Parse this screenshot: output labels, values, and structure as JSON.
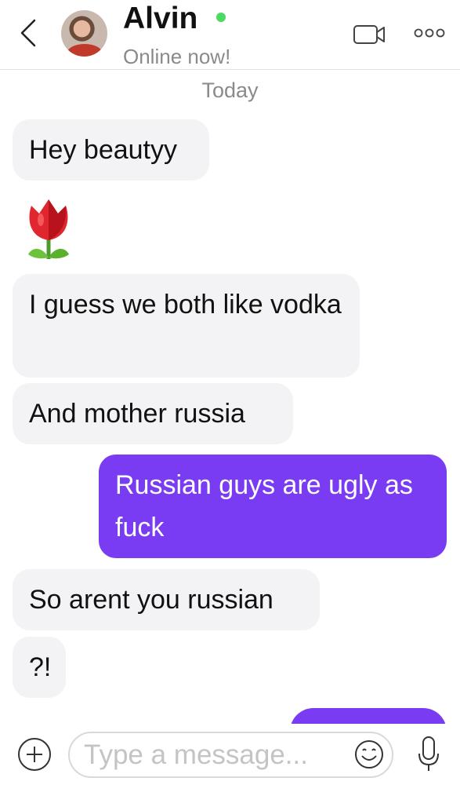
{
  "header": {
    "name": "Alvin",
    "status": "Online now!",
    "online_color": "#4cd964",
    "icons": [
      "back-chevron-icon",
      "avatar",
      "video-call-icon",
      "more-options-icon"
    ]
  },
  "date_separator": "Today",
  "messages": [
    {
      "side": "received",
      "text": "Hey beautyy"
    },
    {
      "side": "received",
      "type": "emoji",
      "icon": "tulip-emoji-icon"
    },
    {
      "side": "received",
      "text": "I guess we both like vodka"
    },
    {
      "side": "received",
      "text": "And mother russia"
    },
    {
      "side": "sent",
      "text": "Russian guys are ugly as fuck"
    },
    {
      "side": "received",
      "text": "So arent you russian"
    },
    {
      "side": "received",
      "text": "?!"
    },
    {
      "side": "sent",
      "text": ""
    }
  ],
  "composer": {
    "placeholder": "Type a message...",
    "icons": [
      "add-icon",
      "emoji-icon",
      "microphone-icon"
    ]
  },
  "colors": {
    "sent_bubble": "#7a3cf2",
    "received_bubble": "#f3f3f5",
    "muted_text": "#8a8a8a"
  }
}
